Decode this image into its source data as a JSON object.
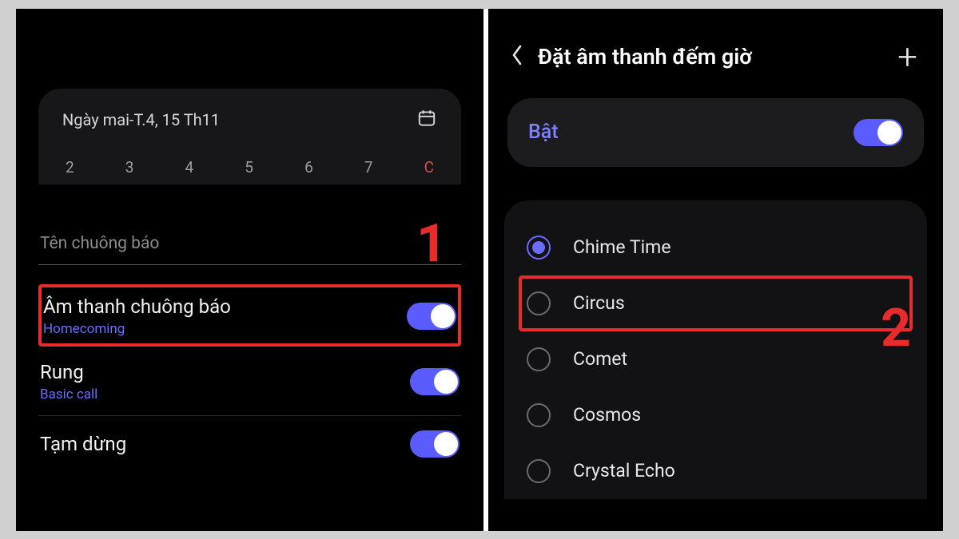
{
  "left": {
    "date_line": "Ngày mai-T.4, 15 Th11",
    "days": [
      "2",
      "3",
      "4",
      "5",
      "6",
      "7",
      "C"
    ],
    "alarm_name_placeholder": "Tên chuông báo",
    "sound": {
      "title": "Âm thanh chuông báo",
      "value": "Homecoming"
    },
    "vibrate": {
      "title": "Rung",
      "value": "Basic call"
    },
    "snooze": {
      "title": "Tạm dừng"
    },
    "step": "1"
  },
  "right": {
    "title": "Đặt âm thanh đếm giờ",
    "enable_label": "Bật",
    "items": [
      {
        "label": "Chime Time",
        "selected": true
      },
      {
        "label": "Circus",
        "selected": false,
        "highlight": true
      },
      {
        "label": "Comet",
        "selected": false
      },
      {
        "label": "Cosmos",
        "selected": false
      },
      {
        "label": "Crystal Echo",
        "selected": false
      }
    ],
    "step": "2"
  }
}
